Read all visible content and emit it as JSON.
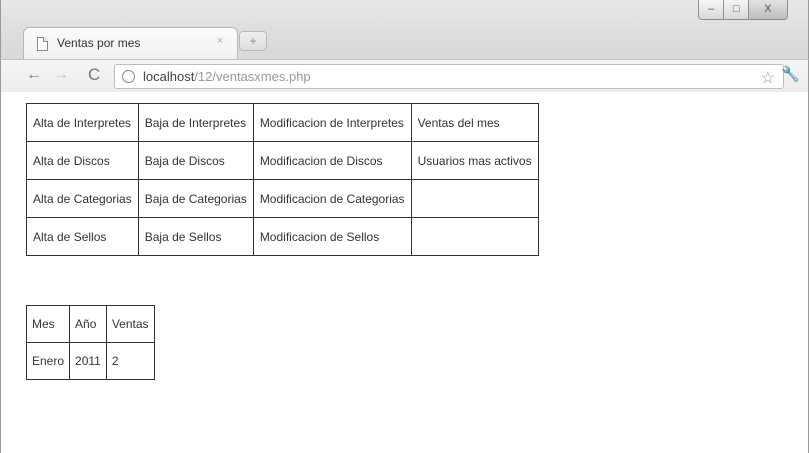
{
  "window": {
    "tab_title": "Ventas por mes",
    "tab_close": "×",
    "newtab_label": "+",
    "win_min": "–",
    "win_max": "□",
    "win_close": "X"
  },
  "toolbar": {
    "url_host": "localhost",
    "url_path": "/12/ventasxmes.php",
    "back": "←",
    "forward": "→",
    "reload": "C",
    "star": "☆",
    "wrench": "🔧"
  },
  "menu": [
    [
      "Alta de Interpretes",
      "Baja de Interpretes",
      "Modificacion de Interpretes",
      "Ventas del mes"
    ],
    [
      "Alta de Discos",
      "Baja de Discos",
      "Modificacion de Discos",
      "Usuarios mas activos"
    ],
    [
      "Alta de Categorias",
      "Baja de Categorias",
      "Modificacion de Categorias",
      ""
    ],
    [
      "Alta de Sellos",
      "Baja de Sellos",
      "Modificacion de Sellos",
      ""
    ]
  ],
  "sales": {
    "headers": [
      "Mes",
      "Año",
      "Ventas"
    ],
    "rows": [
      [
        "Enero",
        "2011",
        "2"
      ]
    ]
  }
}
